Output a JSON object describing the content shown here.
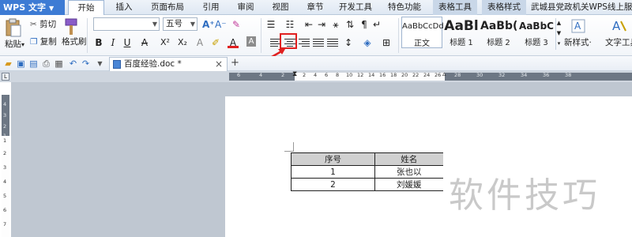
{
  "app": {
    "name": "WPS 文字"
  },
  "menu": {
    "tabs": [
      "开始",
      "插入",
      "页面布局",
      "引用",
      "审阅",
      "视图",
      "章节",
      "开发工具",
      "特色功能",
      "表格工具",
      "表格样式",
      "武城县党政机关WPS线上服务通道"
    ],
    "active_tab": "开始"
  },
  "ribbon": {
    "paste_label": "粘贴",
    "cut_label": "剪切",
    "copy_label": "复制",
    "format_painter_label": "格式刷",
    "font_name_value": "",
    "font_size_value": "五号",
    "bold": "B",
    "italic": "I",
    "underline": "U",
    "strike": "A",
    "superscript": "X²",
    "subscript": "X₂",
    "font_color_letter": "A",
    "styles": [
      {
        "sample": "AaBbCcDd",
        "label": "正文"
      },
      {
        "sample": "AaBl",
        "label": "标题 1"
      },
      {
        "sample": "AaBb(",
        "label": "标题 2"
      },
      {
        "sample": "AaBbC",
        "label": "标题 3"
      }
    ],
    "new_style_label": "新样式·",
    "text_tools_label": "文字工具"
  },
  "quickbar": {
    "doc_tab_title": "百度经验.doc *",
    "close_glyph": "×",
    "new_tab_glyph": "+"
  },
  "ruler": {
    "h_left_numbers": [
      "6",
      "4",
      "2"
    ],
    "h_right_numbers": [
      "2",
      "4",
      "6",
      "8",
      "10",
      "12",
      "14",
      "16",
      "18",
      "20",
      "22",
      "24",
      "26",
      "28",
      "30",
      "32",
      "34",
      "36",
      "38"
    ],
    "v_numbers": [
      "4",
      "3",
      "2",
      "1",
      "1",
      "2",
      "3",
      "4",
      "5",
      "6",
      "7"
    ]
  },
  "document": {
    "table": {
      "headers": [
        "序号",
        "姓名"
      ],
      "rows": [
        [
          "1",
          "张也以"
        ],
        [
          "2",
          "刘媛媛"
        ]
      ]
    }
  },
  "watermark": "软件技巧",
  "colors": {
    "accent": "#3d7bd4",
    "highlight_box": "#e02020",
    "table_header_bg": "#d0d0d0",
    "workspace_bg": "#bfc7d1"
  }
}
